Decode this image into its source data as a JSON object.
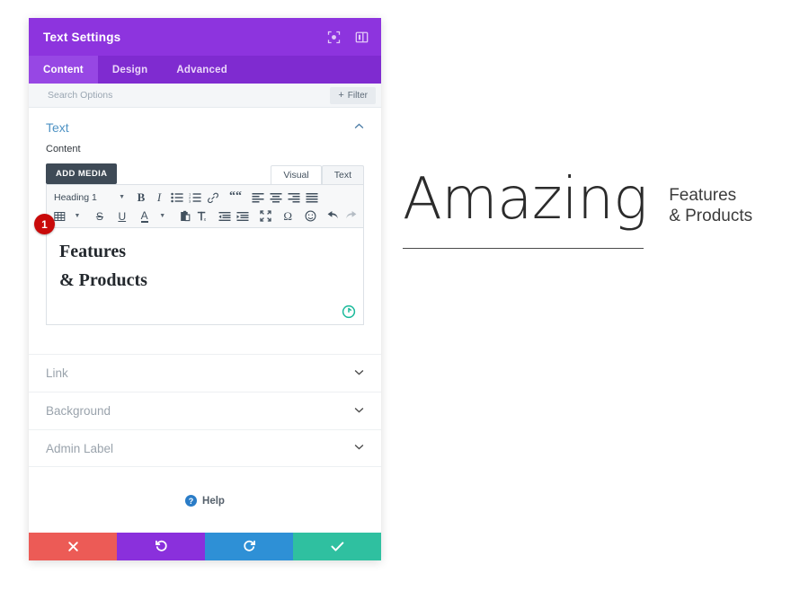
{
  "modal": {
    "title": "Text Settings",
    "header_icons": [
      {
        "name": "expand-icon",
        "label": "Expand"
      },
      {
        "name": "layout-icon",
        "label": "Layout"
      }
    ],
    "tabs": [
      {
        "label": "Content",
        "active": true
      },
      {
        "label": "Design",
        "active": false
      },
      {
        "label": "Advanced",
        "active": false
      }
    ],
    "search": {
      "placeholder": "Search Options",
      "value": ""
    },
    "filter_button": {
      "plus": "+",
      "label": "Filter"
    },
    "text_section": {
      "title": "Text",
      "chevron": "collapse-up",
      "content_label": "Content",
      "add_media_label": "ADD MEDIA",
      "editor_tabs": [
        {
          "label": "Visual",
          "active": true
        },
        {
          "label": "Text",
          "active": false
        }
      ],
      "format_select": {
        "value": "Heading 1"
      },
      "toolbar_row_1": [
        "bold-icon",
        "italic-icon",
        "bulleted-list-icon",
        "numbered-list-icon",
        "link-icon",
        "blockquote-icon",
        "align-left-icon",
        "align-center-icon",
        "align-right-icon",
        "align-justify-icon"
      ],
      "toolbar_row_2": [
        "table-icon",
        "strikethrough-icon",
        "underline-icon",
        "text-color-icon",
        "paste-icon",
        "clear-formatting-icon",
        "outdent-icon",
        "indent-icon",
        "fullscreen-icon",
        "special-character-icon",
        "emoji-icon",
        "undo-icon",
        "redo-icon"
      ],
      "editor_content_line1": "Features",
      "editor_content_line2": "& Products",
      "reset_icon": "reset-icon",
      "step_badge": "1"
    },
    "accordions": [
      {
        "label": "Link"
      },
      {
        "label": "Background"
      },
      {
        "label": "Admin Label"
      }
    ],
    "help": {
      "icon_glyph": "?",
      "label": "Help"
    },
    "footer_buttons": [
      {
        "name": "cancel-button",
        "icon": "close-icon",
        "color": "#EC5B56"
      },
      {
        "name": "undo-button",
        "icon": "undo-icon",
        "color": "#8A30DC"
      },
      {
        "name": "redo-button",
        "icon": "redo-icon",
        "color": "#2E90D6"
      },
      {
        "name": "save-button",
        "icon": "check-icon",
        "color": "#2FC0A0"
      }
    ]
  },
  "preview": {
    "headline": "Amazing",
    "subtext": "Features\n& Products"
  },
  "colors": {
    "header_purple": "#8D34DE",
    "tabbar_purple": "#7F2BD0",
    "active_tab": "#9747E4",
    "section_title_blue": "#4F93C4",
    "badge_red": "#C90A0A",
    "reset_green": "#19B99A"
  }
}
